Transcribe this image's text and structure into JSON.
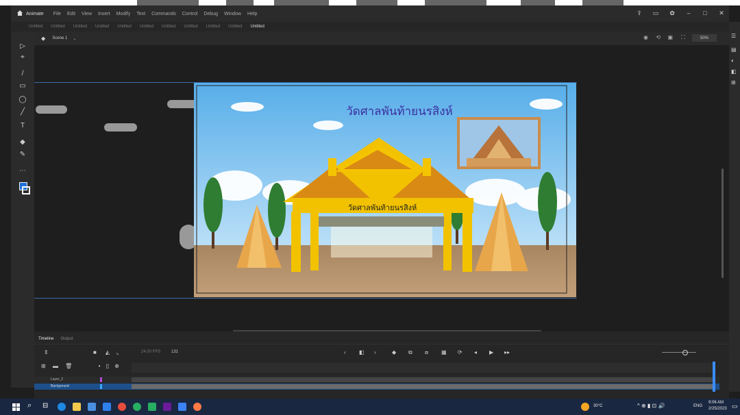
{
  "window": {
    "app_name": "Animate",
    "menus": [
      "File",
      "Edit",
      "View",
      "Insert",
      "Modify",
      "Text",
      "Commands",
      "Control",
      "Debug",
      "Window",
      "Help"
    ],
    "tabs": [
      "Untitled",
      "Untitled",
      "Untitled",
      "Untitled",
      "Untitled",
      "Untitled",
      "Untitled",
      "Untitled",
      "Untitled",
      "Untitled",
      "Untitled",
      "Untitled"
    ],
    "active_tab": "Untitled"
  },
  "scene": {
    "label": "Scene 1",
    "zoom": "50%"
  },
  "stage": {
    "title": "วัดศาลพันท้ายนรสิงห์",
    "gate_sign": "วัดศาลพันท้ายนรสิงห์"
  },
  "timeline": {
    "tab_timeline": "Timeline",
    "tab_output": "Output",
    "fps": "24.00 FPS",
    "frame": "131",
    "layers": [
      {
        "name": "Layer_2"
      },
      {
        "name": "Background"
      }
    ]
  },
  "taskbar": {
    "weather": "30°C",
    "time": "9:06 AM",
    "date": "2/25/2023",
    "lang": "ENG"
  },
  "colors": {
    "accent": "#1e6fd9",
    "stage_sky": "#6fb9f0",
    "ground": "#b8946a",
    "gold": "#f2c200"
  }
}
